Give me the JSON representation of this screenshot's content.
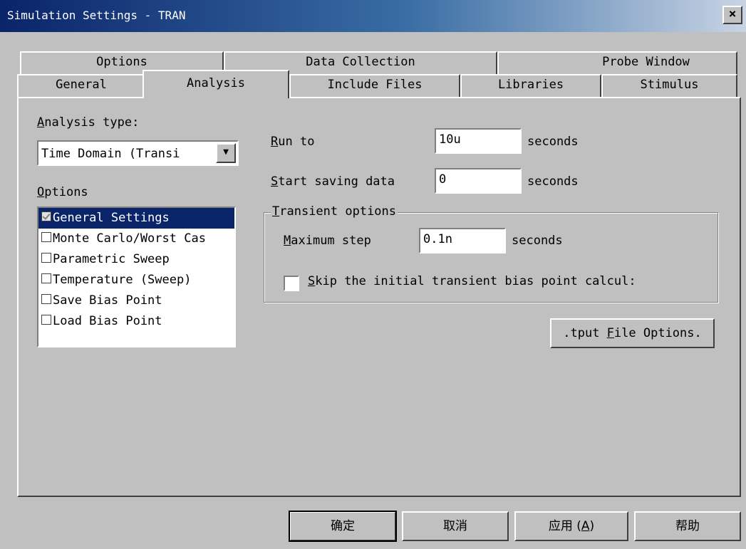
{
  "window": {
    "title": "Simulation Settings - TRAN",
    "close_icon": "×"
  },
  "tabs_row1": [
    {
      "label": "Options"
    },
    {
      "label": "Data Collection"
    },
    {
      "label": "Probe Window"
    }
  ],
  "tabs_row2": [
    {
      "label": "General"
    },
    {
      "label": "Analysis",
      "active": true
    },
    {
      "label": "Include Files"
    },
    {
      "label": "Libraries"
    },
    {
      "label": "Stimulus"
    }
  ],
  "analysis": {
    "type_label_first": "A",
    "type_label_rest": "nalysis type:",
    "type_value": "Time Domain (Transi",
    "dropdown_icon": "▼",
    "options_label_first": "O",
    "options_label_rest": "ptions",
    "options": [
      {
        "label": "General Settings",
        "checked": true,
        "selected": true
      },
      {
        "label": "Monte Carlo/Worst Cas",
        "checked": false
      },
      {
        "label": "Parametric Sweep",
        "checked": false
      },
      {
        "label": "Temperature (Sweep)",
        "checked": false
      },
      {
        "label": "Save Bias Point",
        "checked": false
      },
      {
        "label": "Load Bias Point",
        "checked": false
      }
    ]
  },
  "run_to": {
    "label_first": "R",
    "label_rest": "un to",
    "value": "10u",
    "unit": "seconds"
  },
  "start_saving": {
    "label_first": "S",
    "label_rest": "tart saving data",
    "value": "0",
    "unit": "seconds"
  },
  "transient": {
    "group_first": "T",
    "group_rest": "ransient options",
    "max_step_first": "M",
    "max_step_rest": "aximum step",
    "max_step_value": "0.1n",
    "max_step_unit": "seconds",
    "skip_first": "S",
    "skip_rest": "kip the initial transient bias point calcul:"
  },
  "output_file_btn": {
    "pre": ".tput ",
    "u": "F",
    "post": "ile Options."
  },
  "buttons": {
    "ok": "确定",
    "cancel": "取消",
    "apply_pre": "应用 (",
    "apply_u": "A",
    "apply_post": ")",
    "help": "帮助"
  }
}
